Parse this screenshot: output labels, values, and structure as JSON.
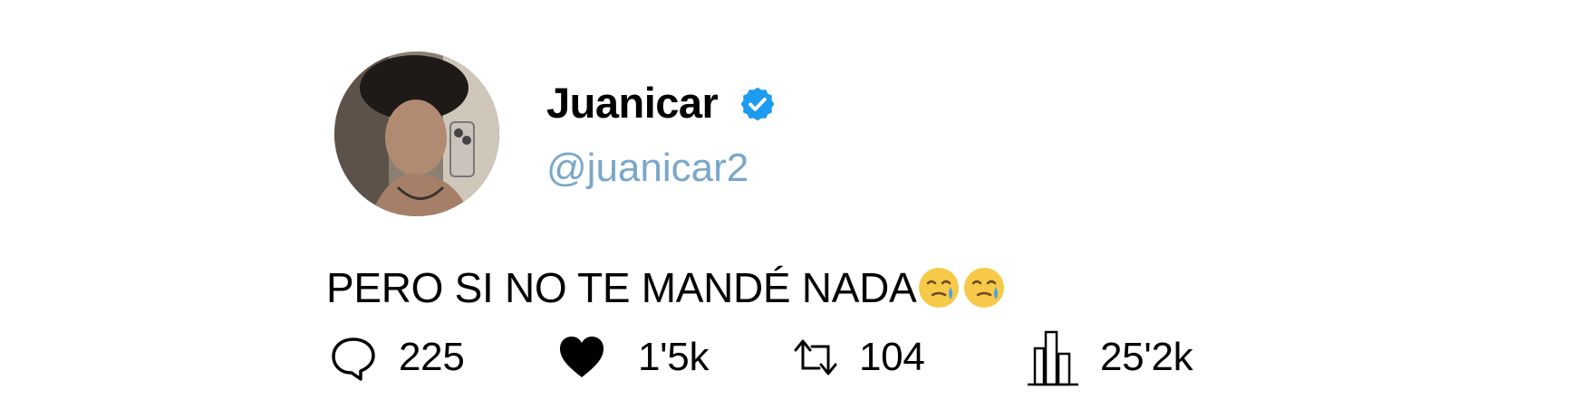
{
  "user": {
    "display_name": "Juanicar",
    "handle": "@juanicar2",
    "verified_icon": "verified-badge-icon",
    "verified_color": "#1d9bf0"
  },
  "tweet": {
    "text": "PERO SI NO TE MANDÉ NADA",
    "emojis": [
      "face-holding-back-tears",
      "face-holding-back-tears"
    ]
  },
  "actions": {
    "replies": {
      "icon": "reply-icon",
      "count": "225"
    },
    "likes": {
      "icon": "heart-icon",
      "count": "1'5k"
    },
    "retweets": {
      "icon": "retweet-icon",
      "count": "104"
    },
    "views": {
      "icon": "views-icon",
      "count": "25'2k"
    }
  },
  "colors": {
    "handle": "#7aa7c9",
    "text": "#000000",
    "background": "#ffffff"
  }
}
